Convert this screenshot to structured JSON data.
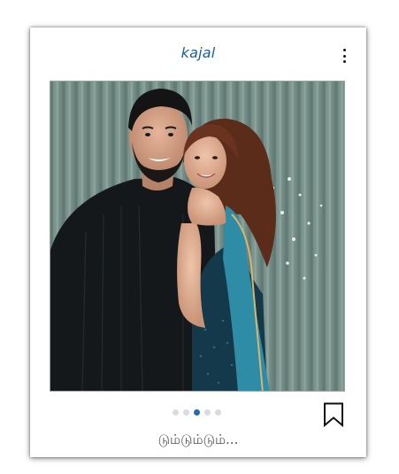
{
  "post": {
    "username": "kajal",
    "caption": "டும்டும்டும்...",
    "carousel": {
      "total": 5,
      "active_index": 2
    }
  },
  "icons": {
    "more": "more-vertical-icon",
    "bookmark": "bookmark-icon"
  },
  "colors": {
    "accent": "#1f6eb3",
    "username": "#1b5fa3",
    "dot_inactive": "#d9dcdf"
  }
}
